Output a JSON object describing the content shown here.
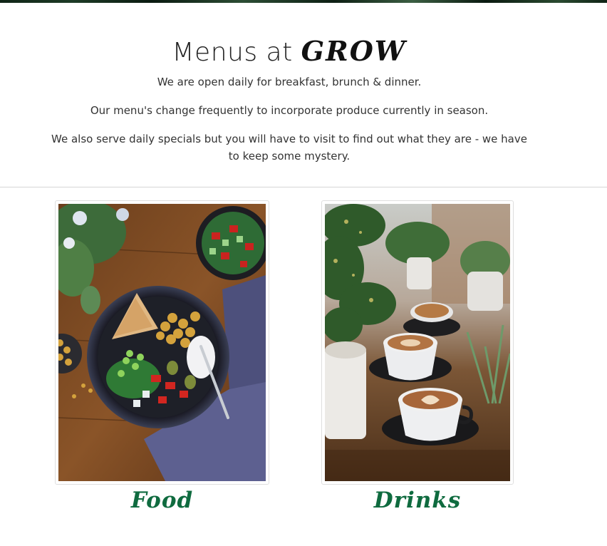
{
  "header": {
    "title_prefix": "Menus at",
    "brand": "GROW"
  },
  "intro": {
    "p1": "We are open daily for breakfast, brunch & dinner.",
    "p2": "Our menu's change frequently to incorporate produce currently in season.",
    "p3": "We also serve daily specials but you will have to visit to find out what they are - we have to keep some mystery."
  },
  "menus": [
    {
      "label": "Food",
      "image": "food-bowl-photo"
    },
    {
      "label": "Drinks",
      "image": "coffee-drinks-photo"
    }
  ],
  "colors": {
    "menu_label": "#0f6b3f",
    "text": "#333333",
    "divider": "#d6d6d6"
  }
}
